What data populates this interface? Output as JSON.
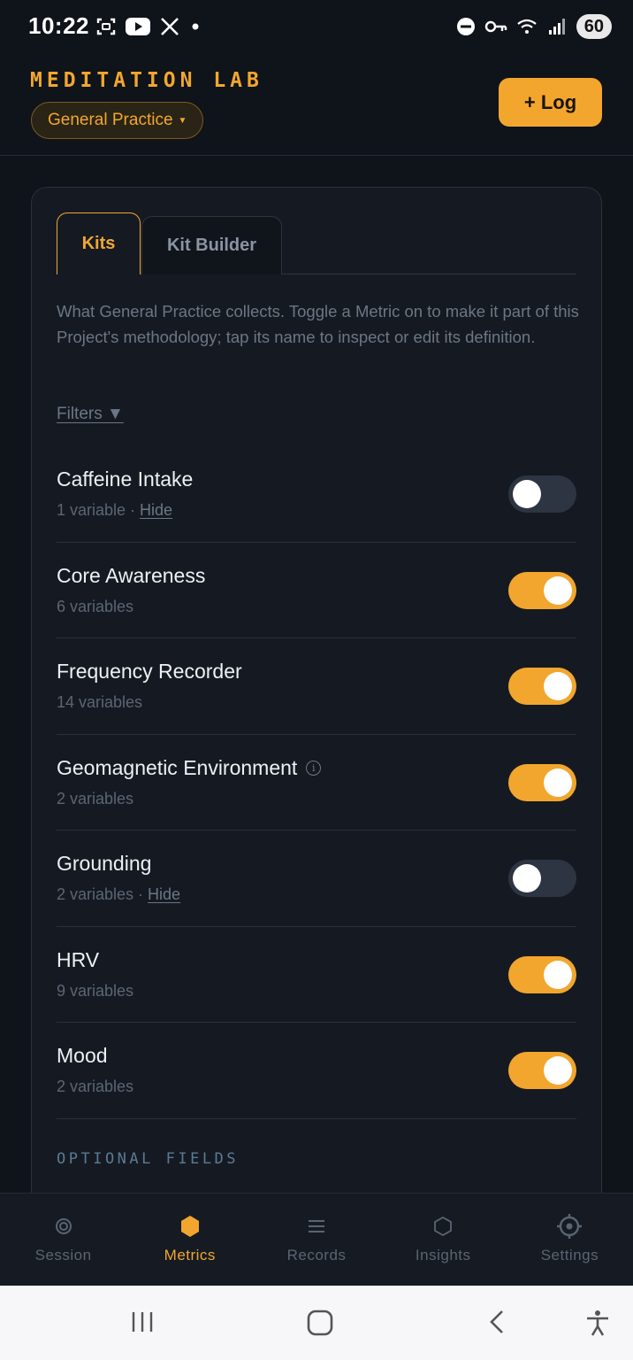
{
  "status_bar": {
    "time": "10:22",
    "battery": "60",
    "icons": [
      "screenshot-icon",
      "youtube-icon",
      "x-icon",
      "dot-icon",
      "dnd-icon",
      "vpn-key-icon",
      "wifi-icon",
      "signal-icon"
    ]
  },
  "header": {
    "title": "MEDITATION LAB",
    "project": "General Practice",
    "log_button": "+ Log"
  },
  "tabs": [
    {
      "label": "Kits",
      "active": true
    },
    {
      "label": "Kit Builder",
      "active": false
    }
  ],
  "description": "What General Practice collects. Toggle a Metric on to make it part of this Project's methodology; tap its name to inspect or edit its definition.",
  "filters_label": "Filters ▼",
  "metrics": [
    {
      "name": "Caffeine Intake",
      "variables": "1 variable",
      "hide": "Hide",
      "enabled": false
    },
    {
      "name": "Core Awareness",
      "variables": "6 variables",
      "enabled": true
    },
    {
      "name": "Frequency Recorder",
      "variables": "14 variables",
      "enabled": true
    },
    {
      "name": "Geomagnetic Environment",
      "variables": "2 variables",
      "info": true,
      "enabled": true
    },
    {
      "name": "Grounding",
      "variables": "2 variables",
      "hide": "Hide",
      "enabled": false
    },
    {
      "name": "HRV",
      "variables": "9 variables",
      "enabled": true
    },
    {
      "name": "Mood",
      "variables": "2 variables",
      "enabled": true
    }
  ],
  "section_heading": "OPTIONAL FIELDS",
  "separator": " · ",
  "nav": [
    {
      "label": "Session",
      "icon": "target-icon",
      "active": false
    },
    {
      "label": "Metrics",
      "icon": "hexagon-filled-icon",
      "active": true
    },
    {
      "label": "Records",
      "icon": "list-icon",
      "active": false
    },
    {
      "label": "Insights",
      "icon": "hexagon-outline-icon",
      "active": false
    },
    {
      "label": "Settings",
      "icon": "gear-icon",
      "active": false
    }
  ],
  "colors": {
    "accent": "#f2a62e",
    "background": "#0f131a",
    "card": "#151a22",
    "toggle_off": "#2d3542"
  }
}
